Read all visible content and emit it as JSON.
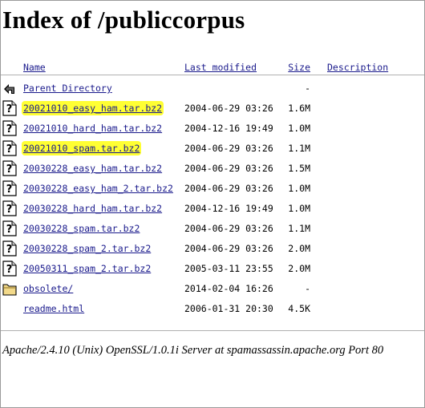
{
  "page": {
    "title": "Index of /publiccorpus"
  },
  "columns": {
    "name": "Name",
    "last_modified": "Last modified",
    "size": "Size",
    "description": "Description"
  },
  "rows": [
    {
      "icon": "back-arrow-icon",
      "name": "Parent Directory",
      "date": "",
      "size": "-",
      "highlight": false
    },
    {
      "icon": "unknown-file-icon",
      "name": "20021010_easy_ham.tar.bz2",
      "date": "2004-06-29 03:26",
      "size": "1.6M",
      "highlight": true
    },
    {
      "icon": "unknown-file-icon",
      "name": "20021010_hard_ham.tar.bz2",
      "date": "2004-12-16 19:49",
      "size": "1.0M",
      "highlight": false
    },
    {
      "icon": "unknown-file-icon",
      "name": "20021010_spam.tar.bz2",
      "date": "2004-06-29 03:26",
      "size": "1.1M",
      "highlight": true
    },
    {
      "icon": "unknown-file-icon",
      "name": "20030228_easy_ham.tar.bz2",
      "date": "2004-06-29 03:26",
      "size": "1.5M",
      "highlight": false
    },
    {
      "icon": "unknown-file-icon",
      "name": "20030228_easy_ham_2.tar.bz2",
      "date": "2004-06-29 03:26",
      "size": "1.0M",
      "highlight": false
    },
    {
      "icon": "unknown-file-icon",
      "name": "20030228_hard_ham.tar.bz2",
      "date": "2004-12-16 19:49",
      "size": "1.0M",
      "highlight": false
    },
    {
      "icon": "unknown-file-icon",
      "name": "20030228_spam.tar.bz2",
      "date": "2004-06-29 03:26",
      "size": "1.1M",
      "highlight": false
    },
    {
      "icon": "unknown-file-icon",
      "name": "20030228_spam_2.tar.bz2",
      "date": "2004-06-29 03:26",
      "size": "2.0M",
      "highlight": false
    },
    {
      "icon": "unknown-file-icon",
      "name": "20050311_spam_2.tar.bz2",
      "date": "2005-03-11 23:55",
      "size": "2.0M",
      "highlight": false
    },
    {
      "icon": "folder-icon",
      "name": "obsolete/",
      "date": "2014-02-04 16:26",
      "size": "-",
      "highlight": false
    },
    {
      "icon": "none",
      "name": "readme.html",
      "date": "2006-01-31 20:30",
      "size": "4.5K",
      "highlight": false
    }
  ],
  "footer": {
    "text": "Apache/2.4.10 (Unix) OpenSSL/1.0.1i Server at spamassassin.apache.org Port 80"
  },
  "colors": {
    "link": "#1a1a8c",
    "highlight": "#ffff33"
  }
}
